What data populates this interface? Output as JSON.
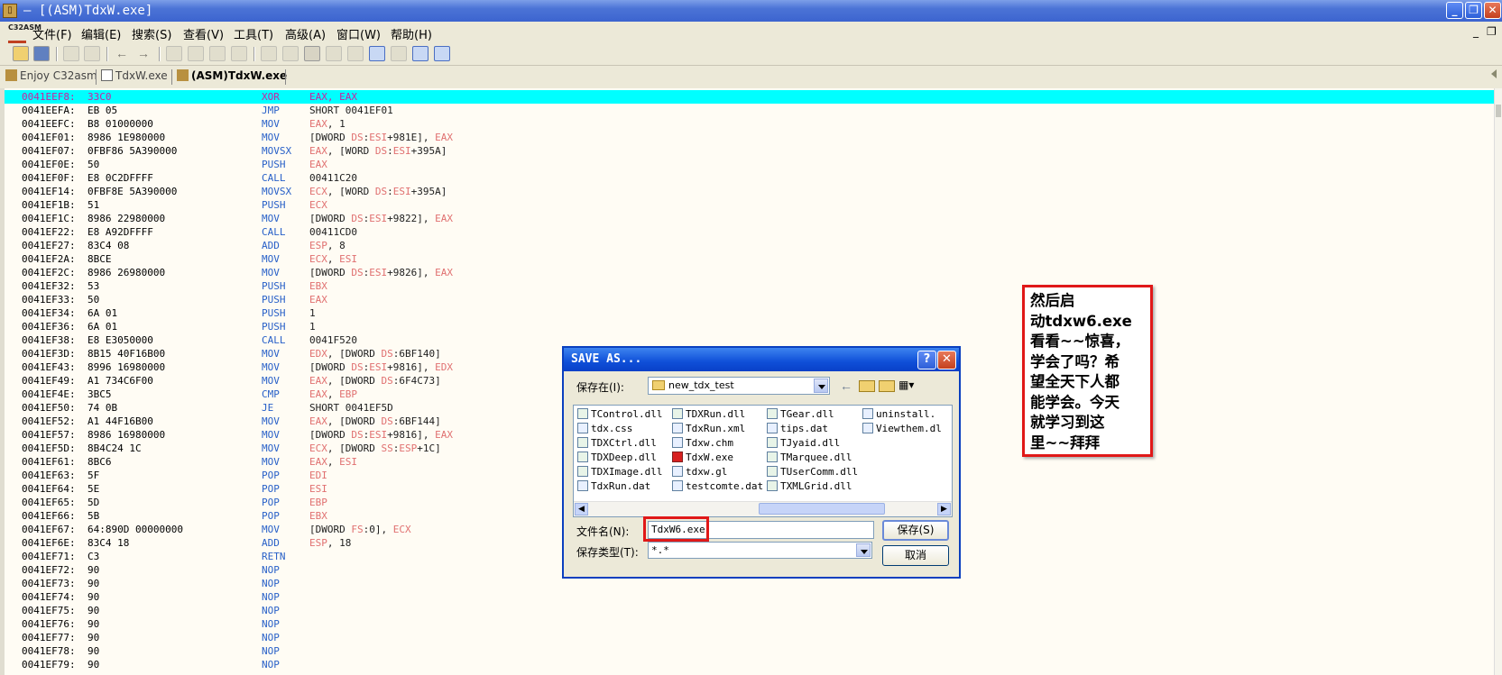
{
  "window": {
    "title": "— [(ASM)TdxW.exe]"
  },
  "menu": {
    "logo": "C32ASM",
    "items": [
      "文件(F)",
      "编辑(E)",
      "搜索(S)",
      "查看(V)",
      "工具(T)",
      "高级(A)",
      "窗口(W)",
      "帮助(H)"
    ]
  },
  "tabs": [
    {
      "label": "Enjoy C32asm",
      "active": false
    },
    {
      "label": "TdxW.exe",
      "active": false
    },
    {
      "label": "(ASM)TdxW.exe",
      "active": true
    }
  ],
  "rows": [
    {
      "a": "0041EEF8:",
      "h": "33C0",
      "m": "XOR",
      "o": "EAX, EAX"
    },
    {
      "a": "0041EEFA:",
      "h": "EB 05",
      "m": "JMP",
      "o": "SHORT 0041EF01"
    },
    {
      "a": "0041EEFC:",
      "h": "B8 01000000",
      "m": "MOV",
      "o": "EAX, 1"
    },
    {
      "a": "0041EF01:",
      "h": "8986 1E980000",
      "m": "MOV",
      "o": "[DWORD DS:ESI+981E], EAX"
    },
    {
      "a": "0041EF07:",
      "h": "0FBF86 5A390000",
      "m": "MOVSX",
      "o": "EAX, [WORD DS:ESI+395A]"
    },
    {
      "a": "0041EF0E:",
      "h": "50",
      "m": "PUSH",
      "o": "EAX"
    },
    {
      "a": "0041EF0F:",
      "h": "E8 0C2DFFFF",
      "m": "CALL",
      "o": "00411C20"
    },
    {
      "a": "0041EF14:",
      "h": "0FBF8E 5A390000",
      "m": "MOVSX",
      "o": "ECX, [WORD DS:ESI+395A]"
    },
    {
      "a": "0041EF1B:",
      "h": "51",
      "m": "PUSH",
      "o": "ECX"
    },
    {
      "a": "0041EF1C:",
      "h": "8986 22980000",
      "m": "MOV",
      "o": "[DWORD DS:ESI+9822], EAX"
    },
    {
      "a": "0041EF22:",
      "h": "E8 A92DFFFF",
      "m": "CALL",
      "o": "00411CD0"
    },
    {
      "a": "0041EF27:",
      "h": "83C4 08",
      "m": "ADD",
      "o": "ESP, 8"
    },
    {
      "a": "0041EF2A:",
      "h": "8BCE",
      "m": "MOV",
      "o": "ECX, ESI"
    },
    {
      "a": "0041EF2C:",
      "h": "8986 26980000",
      "m": "MOV",
      "o": "[DWORD DS:ESI+9826], EAX"
    },
    {
      "a": "0041EF32:",
      "h": "53",
      "m": "PUSH",
      "o": "EBX"
    },
    {
      "a": "0041EF33:",
      "h": "50",
      "m": "PUSH",
      "o": "EAX"
    },
    {
      "a": "0041EF34:",
      "h": "6A 01",
      "m": "PUSH",
      "o": "1"
    },
    {
      "a": "0041EF36:",
      "h": "6A 01",
      "m": "PUSH",
      "o": "1"
    },
    {
      "a": "0041EF38:",
      "h": "E8 E3050000",
      "m": "CALL",
      "o": "0041F520"
    },
    {
      "a": "0041EF3D:",
      "h": "8B15 40F16B00",
      "m": "MOV",
      "o": "EDX, [DWORD DS:6BF140]"
    },
    {
      "a": "0041EF43:",
      "h": "8996 16980000",
      "m": "MOV",
      "o": "[DWORD DS:ESI+9816], EDX"
    },
    {
      "a": "0041EF49:",
      "h": "A1 734C6F00",
      "m": "MOV",
      "o": "EAX, [DWORD DS:6F4C73]"
    },
    {
      "a": "0041EF4E:",
      "h": "3BC5",
      "m": "CMP",
      "o": "EAX, EBP"
    },
    {
      "a": "0041EF50:",
      "h": "74 0B",
      "m": "JE",
      "o": "SHORT 0041EF5D"
    },
    {
      "a": "0041EF52:",
      "h": "A1 44F16B00",
      "m": "MOV",
      "o": "EAX, [DWORD DS:6BF144]"
    },
    {
      "a": "0041EF57:",
      "h": "8986 16980000",
      "m": "MOV",
      "o": "[DWORD DS:ESI+9816], EAX"
    },
    {
      "a": "0041EF5D:",
      "h": "8B4C24 1C",
      "m": "MOV",
      "o": "ECX, [DWORD SS:ESP+1C]"
    },
    {
      "a": "0041EF61:",
      "h": "8BC6",
      "m": "MOV",
      "o": "EAX, ESI"
    },
    {
      "a": "0041EF63:",
      "h": "5F",
      "m": "POP",
      "o": "EDI"
    },
    {
      "a": "0041EF64:",
      "h": "5E",
      "m": "POP",
      "o": "ESI"
    },
    {
      "a": "0041EF65:",
      "h": "5D",
      "m": "POP",
      "o": "EBP"
    },
    {
      "a": "0041EF66:",
      "h": "5B",
      "m": "POP",
      "o": "EBX"
    },
    {
      "a": "0041EF67:",
      "h": "64:890D 00000000",
      "m": "MOV",
      "o": "[DWORD FS:0], ECX"
    },
    {
      "a": "0041EF6E:",
      "h": "83C4 18",
      "m": "ADD",
      "o": "ESP, 18"
    },
    {
      "a": "0041EF71:",
      "h": "C3",
      "m": "RETN",
      "o": ""
    },
    {
      "a": "0041EF72:",
      "h": "90",
      "m": "NOP",
      "o": ""
    },
    {
      "a": "0041EF73:",
      "h": "90",
      "m": "NOP",
      "o": ""
    },
    {
      "a": "0041EF74:",
      "h": "90",
      "m": "NOP",
      "o": ""
    },
    {
      "a": "0041EF75:",
      "h": "90",
      "m": "NOP",
      "o": ""
    },
    {
      "a": "0041EF76:",
      "h": "90",
      "m": "NOP",
      "o": ""
    },
    {
      "a": "0041EF77:",
      "h": "90",
      "m": "NOP",
      "o": ""
    },
    {
      "a": "0041EF78:",
      "h": "90",
      "m": "NOP",
      "o": ""
    },
    {
      "a": "0041EF79:",
      "h": "90",
      "m": "NOP",
      "o": ""
    }
  ],
  "dialog": {
    "title": "SAVE AS...",
    "help": "?",
    "close": "✕",
    "save_in_label": "保存在(I):",
    "save_in_value": "new_tdx_test",
    "files": [
      [
        "TControl.dll",
        "tdx.css",
        "TDXCtrl.dll",
        "TDXDeep.dll",
        "TDXImage.dll",
        "TdxRun.dat"
      ],
      [
        "TDXRun.dll",
        "TdxRun.xml",
        "Tdxw.chm",
        "TdxW.exe",
        "tdxw.gl",
        "testcomte.dat"
      ],
      [
        "TGear.dll",
        "tips.dat",
        "TJyaid.dll",
        "TMarquee.dll",
        "TUserComm.dll",
        "TXMLGrid.dll"
      ],
      [
        "uninstall.",
        "Viewthem.dl"
      ]
    ],
    "filename_label": "文件名(N):",
    "filename_value": "TdxW6.exe",
    "filetype_label": "保存类型(T):",
    "filetype_value": "*.*",
    "save_button": "保存(S)",
    "cancel_button": "取消"
  },
  "annotation": {
    "lines": [
      "然后启",
      "动tdxw6.exe",
      "看看~~惊喜，",
      "学会了吗？希",
      "望全天下人都",
      "能学会。今天",
      "就学习到这",
      "里~~拜拜"
    ]
  },
  "colors": {
    "selected_row": "#00ffff",
    "mnemonic": "#2860c8",
    "register": "#e07070",
    "highlight_box": "#e01818"
  }
}
